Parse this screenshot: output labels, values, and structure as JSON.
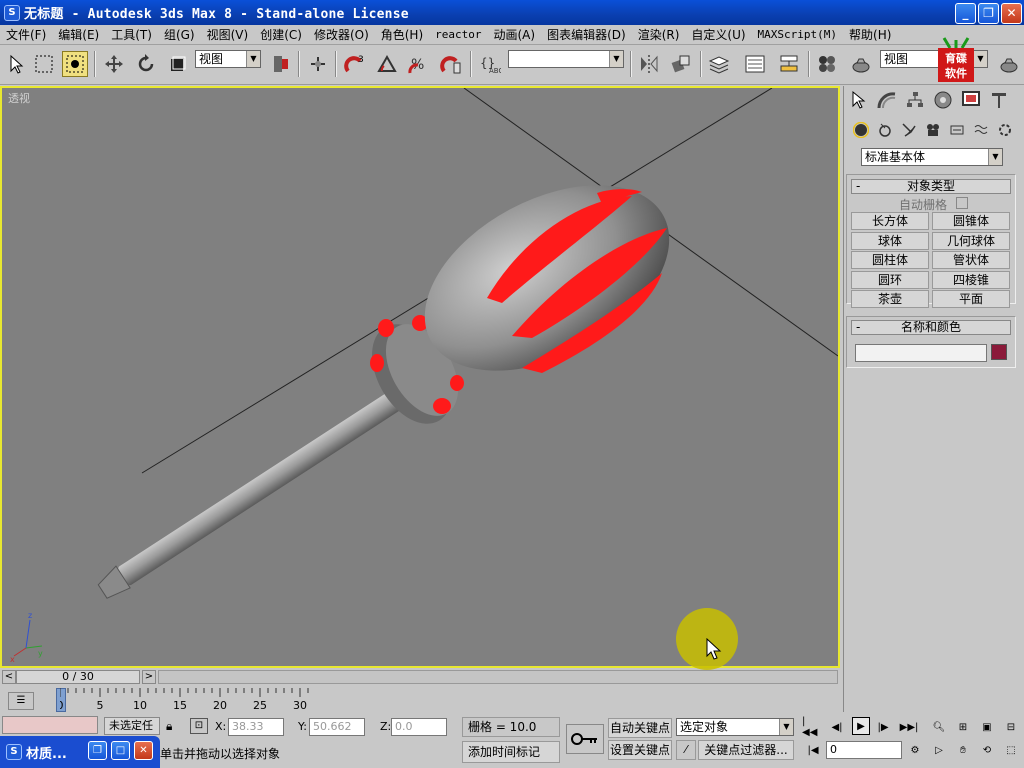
{
  "window": {
    "title": "无标题 - Autodesk 3ds Max 8  - Stand-alone License",
    "icon": "3ds-max-app-icon"
  },
  "menu": [
    "文件(F)",
    "编辑(E)",
    "工具(T)",
    "组(G)",
    "视图(V)",
    "创建(C)",
    "修改器(O)",
    "角色(H)",
    "reactor",
    "动画(A)",
    "图表编辑器(D)",
    "渲染(R)",
    "自定义(U)",
    "MAXScript(M)",
    "帮助(H)"
  ],
  "toolbar": {
    "coord_dropdown": "视图",
    "selection_set": "",
    "right_dropdown": "视图"
  },
  "logo_text": "育碟软件",
  "viewport": {
    "label": "透视",
    "object": "screwdriver"
  },
  "command_panel": {
    "category_dropdown": "标准基本体",
    "object_type": {
      "header": "对象类型",
      "autogrid": "自动栅格",
      "buttons": [
        "长方体",
        "圆锥体",
        "球体",
        "几何球体",
        "圆柱体",
        "管状体",
        "圆环",
        "四棱锥",
        "茶壶",
        "平面"
      ]
    },
    "name_color": {
      "header": "名称和颜色",
      "name": "",
      "color": "#8b1a3a"
    }
  },
  "timeline": {
    "frame": "0 / 30",
    "ticks": [
      "0",
      "5",
      "10",
      "15",
      "20",
      "25",
      "30"
    ]
  },
  "status": {
    "selected": "未选定任",
    "x": "38.33",
    "y": "50.662",
    "z": "0.0",
    "grid": "栅格 = 10.0",
    "auto_key": "自动关键点",
    "selected_object": "选定对象",
    "set_key": "设置关键点",
    "key_filter": "关键点过滤器...",
    "frame_input": "0",
    "prompt": "单击并拖动以选择对象",
    "add_time_tag": "添加时间标记"
  },
  "taskbar": {
    "item": "材质..."
  },
  "colors": {
    "title_blue": "#0a4fd6",
    "viewport_gray": "#808080",
    "active_border": "#e8e830",
    "handle_red": "#ff1a1a"
  }
}
